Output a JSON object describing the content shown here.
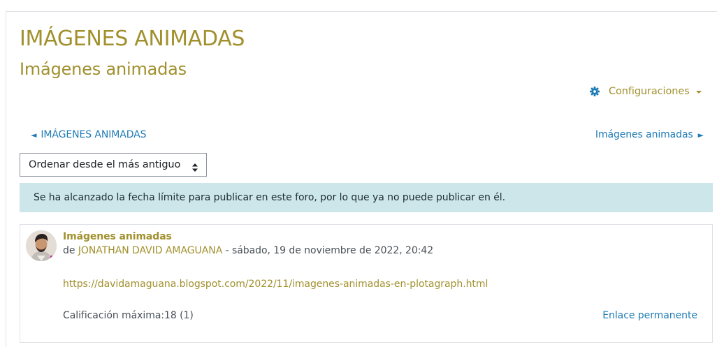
{
  "header": {
    "course_title": "IMÁGENES ANIMADAS",
    "forum_title": "Imágenes animadas"
  },
  "settings_menu": {
    "label": "Configuraciones",
    "icon": "gear-icon"
  },
  "navigation": {
    "prev_label": "IMÁGENES ANIMADAS",
    "prev_arrow": "◄",
    "next_label": "Imágenes animadas",
    "next_arrow": "►"
  },
  "sort": {
    "selected": "Ordenar desde el más antiguo"
  },
  "notice": {
    "text": "Se ha alcanzado la fecha límite para publicar en este foro, por lo que ya no puede publicar en él."
  },
  "post": {
    "subject": "Imágenes animadas",
    "by_prefix": "de ",
    "author": "JONATHAN DAVID AMAGUANA",
    "date": " - sábado, 19 de noviembre de 2022, 20:42",
    "link": "https://davidamaguana.blogspot.com/2022/11/imagenes-animadas-en-plotagraph.html",
    "rating": "Calificación máxima:18 (1)",
    "permalink_label": "Enlace permanente"
  },
  "colors": {
    "brand_gold": "#a1902d",
    "link_blue": "#1f7bb5",
    "notice_bg": "#cde6ea"
  }
}
